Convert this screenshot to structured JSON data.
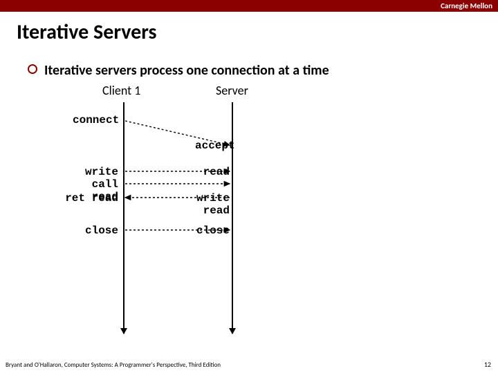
{
  "header": {
    "brand": "Carnegie Mellon"
  },
  "title": "Iterative Servers",
  "bullet_text": "Iterative servers process one connection at a time",
  "columns": {
    "client": "Client 1",
    "server": "Server"
  },
  "events": {
    "c_connect": "connect",
    "c_write": "write",
    "c_call_read": "call read",
    "c_ret_read": "ret read",
    "c_close": "close",
    "s_accept": "accept",
    "s_read1": "read",
    "s_write": "write",
    "s_read2": "read",
    "s_close": "close"
  },
  "footer": "Bryant and O'Hallaron, Computer Systems: A Programmer's Perspective, Third Edition",
  "page": "12"
}
